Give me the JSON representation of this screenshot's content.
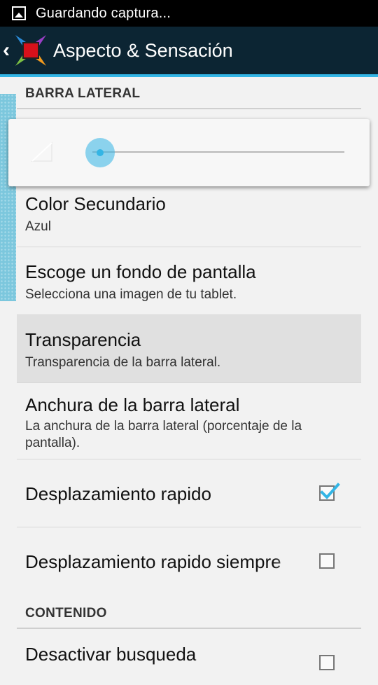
{
  "status_bar": {
    "text": "Guardando captura..."
  },
  "action_bar": {
    "title": "Aspecto & Sensación"
  },
  "sections": [
    {
      "header": "BARRA LATERAL"
    },
    {
      "header": "CONTENIDO"
    }
  ],
  "slider": {
    "value_fraction": 0.03
  },
  "prefs": {
    "color_secundario": {
      "title": "Color Secundario",
      "summary": "Azul"
    },
    "fondo": {
      "title": "Escoge un fondo de pantalla",
      "summary": "Selecciona una imagen de tu tablet."
    },
    "transparencia": {
      "title": "Transparencia",
      "summary": "Transparencia de la barra lateral."
    },
    "anchura": {
      "title": "Anchura de la barra lateral",
      "summary": "La anchura de la barra lateral (porcentaje de la pantalla)."
    },
    "desplazamiento": {
      "title": "Desplazamiento rapido",
      "checked": true
    },
    "desplazamiento_siempre": {
      "title": "Desplazamiento rapido siempre",
      "checked": false
    },
    "desactivar_busqueda": {
      "title": "Desactivar busqueda",
      "checked": false
    }
  },
  "colors": {
    "accent": "#33b5e5",
    "action_bar": "#0c2533",
    "handle": "#7cc7dd"
  }
}
